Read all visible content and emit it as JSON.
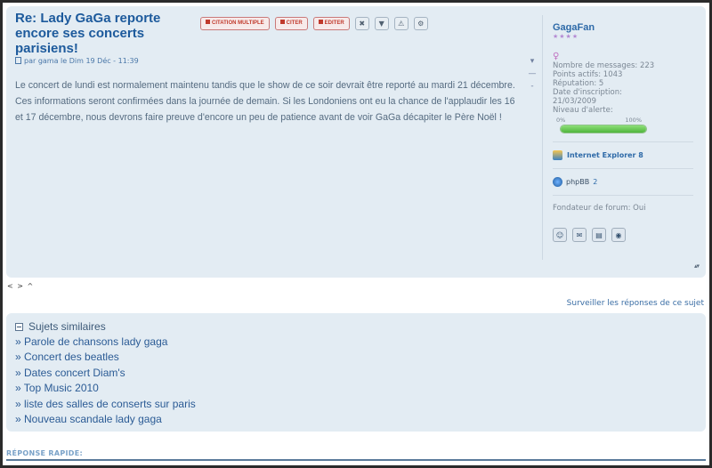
{
  "post": {
    "title": "Re: Lady GaGa reporte encore ses concerts parisiens!",
    "meta": "par gama le Dim 19 Déc - 11:39",
    "body": "Le concert de lundi est normalement maintenu tandis que le show de ce soir devrait être reporté au mardi 21 décembre. Ces informations seront confirmées dans la journée de demain. Si les Londoniens ont eu la chance de l'applaudir les 16 et 17 décembre, nous devrons faire preuve d'encore un peu de patience avant de voir GaGa décapiter le Père Noël !",
    "buttons": {
      "multi_quote": "CITATION MULTIPLE",
      "quote": "CITER",
      "edit": "EDITER"
    },
    "side_marks": {
      "top": "▾",
      "mid": "—",
      "bottom": "-"
    },
    "updown": "▴▾"
  },
  "profile": {
    "username": "GagaFan",
    "stars": "★★★★",
    "gender_icon": "♀",
    "stats": [
      "Nombre de messages: 223",
      "Points actifs: 1043",
      "Réputation: 5",
      "Date d'inscription:",
      "21/03/2009",
      "Niveau d'alerte:"
    ],
    "alert_min": "0%",
    "alert_max": "100%",
    "alert_level": 1.0,
    "browser": "Internet Explorer 8",
    "phpbb_label": "phpBB",
    "phpbb_version": "2",
    "founder": "Fondateur de forum: Oui",
    "icons": [
      "profile-icon",
      "pm-icon",
      "email-icon",
      "website-icon"
    ]
  },
  "nav": {
    "arrows": "< > ^"
  },
  "watch_link": "Surveiller les réponses de ce sujet",
  "similar": {
    "title": "Sujets similaires",
    "items": [
      "» Parole de chansons lady gaga",
      "» Concert des beatles",
      "» Dates concert Diam's",
      "» Top Music 2010",
      "» liste des salles de conserts sur paris",
      "» Nouveau scandale lady gaga"
    ]
  },
  "quick_reply": "RÉPONSE RAPIDE:",
  "colors": {
    "panel_bg": "#e3ecf3",
    "title_blue": "#1d5a9c",
    "link_blue": "#2b5b95",
    "button_red": "#c0392b",
    "alert_green": "#4fb53c"
  }
}
